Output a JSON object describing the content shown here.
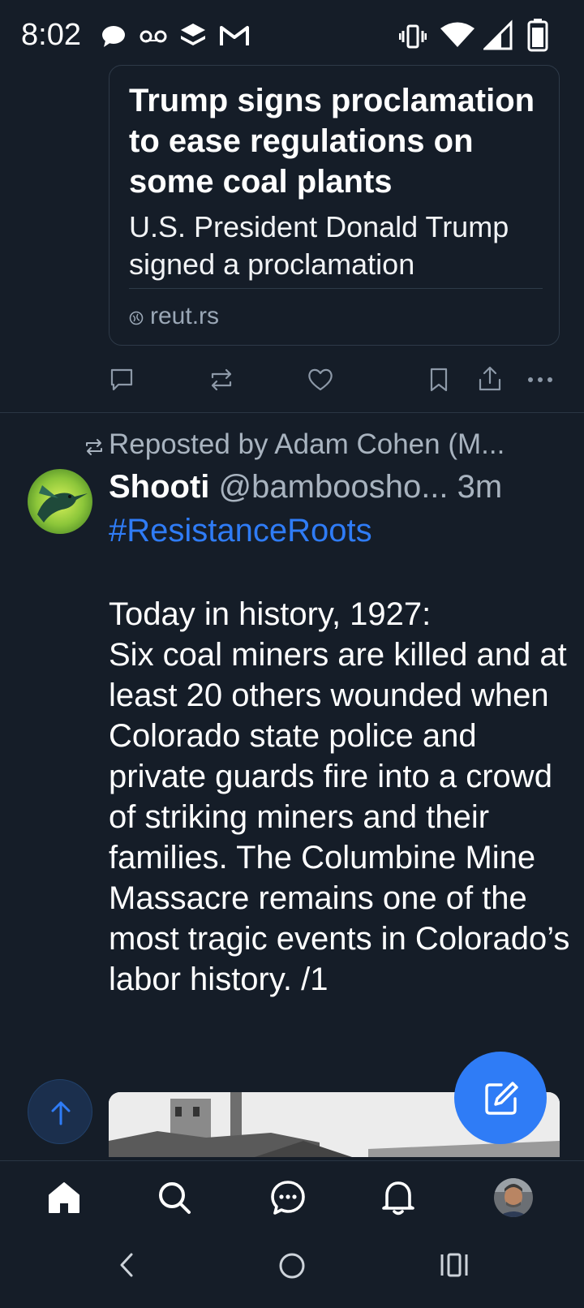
{
  "status_bar": {
    "time": "8:02",
    "notification_icons": [
      "chat-bubble-icon",
      "voicemail-icon",
      "stack-icon",
      "gmail-icon"
    ],
    "system_icons": [
      "vibrate-icon",
      "wifi-icon",
      "signal-icon",
      "battery-icon"
    ]
  },
  "link_card": {
    "title": "Trump signs proclamation to ease regulations on some coal plants",
    "description": "U.S. President Donald Trump signed a proclamation",
    "domain": "reut.rs"
  },
  "actions": [
    "reply-icon",
    "repost-icon",
    "like-icon",
    "bookmark-icon",
    "share-icon",
    "more-icon"
  ],
  "post": {
    "repost_label": "Reposted by Adam Cohen (M...",
    "author_name": "Shooti",
    "author_handle": "@bamboosho...",
    "timestamp": "3m",
    "hashtag": "#ResistanceRoots",
    "body": "Today in history, 1927:\nSix coal miners are killed and at least 20 others wounded when Colorado state police and private guards fire into a crowd of striking miners and their families. The Columbine Mine Massacre remains one of the most tragic events in Colorado’s labor history. /1"
  },
  "colors": {
    "background": "#151d28",
    "accent": "#2f7cf6",
    "muted_text": "#a8b3bf"
  },
  "bottom_nav": [
    "home-icon",
    "search-icon",
    "messages-icon",
    "notifications-icon",
    "profile-avatar"
  ]
}
